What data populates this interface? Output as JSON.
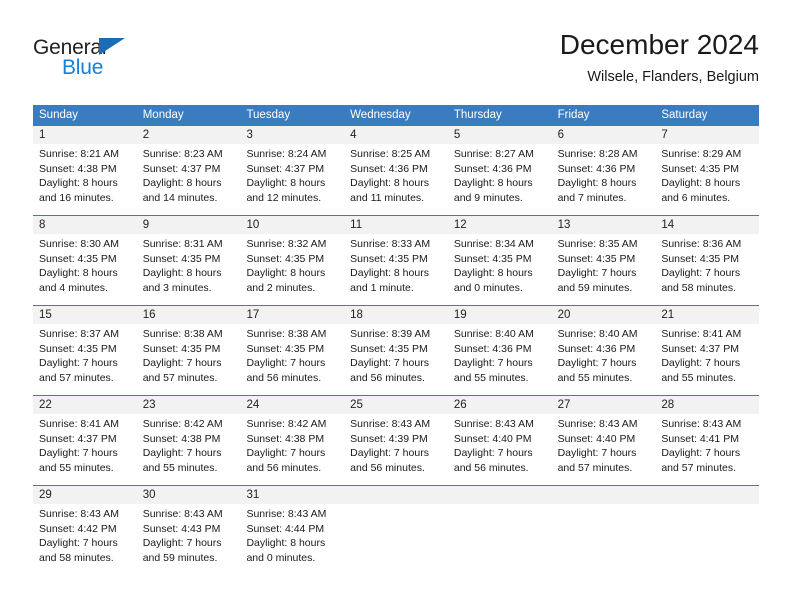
{
  "brand": {
    "name_part1": "General",
    "name_part2": "Blue",
    "triangle_color": "#1b6cb5",
    "blue_color": "#1b7fd4"
  },
  "header": {
    "title": "December 2024",
    "subtitle": "Wilsele, Flanders, Belgium"
  },
  "theme": {
    "header_bg": "#3a7cbf",
    "header_text": "#ffffff",
    "daynum_bg": "#f2f2f2",
    "cell_bg": "#ffffff",
    "border": "#3a7cbf"
  },
  "weekdays": [
    "Sunday",
    "Monday",
    "Tuesday",
    "Wednesday",
    "Thursday",
    "Friday",
    "Saturday"
  ],
  "weeks": [
    [
      {
        "day": "1",
        "sunrise": "Sunrise: 8:21 AM",
        "sunset": "Sunset: 4:38 PM",
        "daylight1": "Daylight: 8 hours",
        "daylight2": "and 16 minutes."
      },
      {
        "day": "2",
        "sunrise": "Sunrise: 8:23 AM",
        "sunset": "Sunset: 4:37 PM",
        "daylight1": "Daylight: 8 hours",
        "daylight2": "and 14 minutes."
      },
      {
        "day": "3",
        "sunrise": "Sunrise: 8:24 AM",
        "sunset": "Sunset: 4:37 PM",
        "daylight1": "Daylight: 8 hours",
        "daylight2": "and 12 minutes."
      },
      {
        "day": "4",
        "sunrise": "Sunrise: 8:25 AM",
        "sunset": "Sunset: 4:36 PM",
        "daylight1": "Daylight: 8 hours",
        "daylight2": "and 11 minutes."
      },
      {
        "day": "5",
        "sunrise": "Sunrise: 8:27 AM",
        "sunset": "Sunset: 4:36 PM",
        "daylight1": "Daylight: 8 hours",
        "daylight2": "and 9 minutes."
      },
      {
        "day": "6",
        "sunrise": "Sunrise: 8:28 AM",
        "sunset": "Sunset: 4:36 PM",
        "daylight1": "Daylight: 8 hours",
        "daylight2": "and 7 minutes."
      },
      {
        "day": "7",
        "sunrise": "Sunrise: 8:29 AM",
        "sunset": "Sunset: 4:35 PM",
        "daylight1": "Daylight: 8 hours",
        "daylight2": "and 6 minutes."
      }
    ],
    [
      {
        "day": "8",
        "sunrise": "Sunrise: 8:30 AM",
        "sunset": "Sunset: 4:35 PM",
        "daylight1": "Daylight: 8 hours",
        "daylight2": "and 4 minutes."
      },
      {
        "day": "9",
        "sunrise": "Sunrise: 8:31 AM",
        "sunset": "Sunset: 4:35 PM",
        "daylight1": "Daylight: 8 hours",
        "daylight2": "and 3 minutes."
      },
      {
        "day": "10",
        "sunrise": "Sunrise: 8:32 AM",
        "sunset": "Sunset: 4:35 PM",
        "daylight1": "Daylight: 8 hours",
        "daylight2": "and 2 minutes."
      },
      {
        "day": "11",
        "sunrise": "Sunrise: 8:33 AM",
        "sunset": "Sunset: 4:35 PM",
        "daylight1": "Daylight: 8 hours",
        "daylight2": "and 1 minute."
      },
      {
        "day": "12",
        "sunrise": "Sunrise: 8:34 AM",
        "sunset": "Sunset: 4:35 PM",
        "daylight1": "Daylight: 8 hours",
        "daylight2": "and 0 minutes."
      },
      {
        "day": "13",
        "sunrise": "Sunrise: 8:35 AM",
        "sunset": "Sunset: 4:35 PM",
        "daylight1": "Daylight: 7 hours",
        "daylight2": "and 59 minutes."
      },
      {
        "day": "14",
        "sunrise": "Sunrise: 8:36 AM",
        "sunset": "Sunset: 4:35 PM",
        "daylight1": "Daylight: 7 hours",
        "daylight2": "and 58 minutes."
      }
    ],
    [
      {
        "day": "15",
        "sunrise": "Sunrise: 8:37 AM",
        "sunset": "Sunset: 4:35 PM",
        "daylight1": "Daylight: 7 hours",
        "daylight2": "and 57 minutes."
      },
      {
        "day": "16",
        "sunrise": "Sunrise: 8:38 AM",
        "sunset": "Sunset: 4:35 PM",
        "daylight1": "Daylight: 7 hours",
        "daylight2": "and 57 minutes."
      },
      {
        "day": "17",
        "sunrise": "Sunrise: 8:38 AM",
        "sunset": "Sunset: 4:35 PM",
        "daylight1": "Daylight: 7 hours",
        "daylight2": "and 56 minutes."
      },
      {
        "day": "18",
        "sunrise": "Sunrise: 8:39 AM",
        "sunset": "Sunset: 4:35 PM",
        "daylight1": "Daylight: 7 hours",
        "daylight2": "and 56 minutes."
      },
      {
        "day": "19",
        "sunrise": "Sunrise: 8:40 AM",
        "sunset": "Sunset: 4:36 PM",
        "daylight1": "Daylight: 7 hours",
        "daylight2": "and 55 minutes."
      },
      {
        "day": "20",
        "sunrise": "Sunrise: 8:40 AM",
        "sunset": "Sunset: 4:36 PM",
        "daylight1": "Daylight: 7 hours",
        "daylight2": "and 55 minutes."
      },
      {
        "day": "21",
        "sunrise": "Sunrise: 8:41 AM",
        "sunset": "Sunset: 4:37 PM",
        "daylight1": "Daylight: 7 hours",
        "daylight2": "and 55 minutes."
      }
    ],
    [
      {
        "day": "22",
        "sunrise": "Sunrise: 8:41 AM",
        "sunset": "Sunset: 4:37 PM",
        "daylight1": "Daylight: 7 hours",
        "daylight2": "and 55 minutes."
      },
      {
        "day": "23",
        "sunrise": "Sunrise: 8:42 AM",
        "sunset": "Sunset: 4:38 PM",
        "daylight1": "Daylight: 7 hours",
        "daylight2": "and 55 minutes."
      },
      {
        "day": "24",
        "sunrise": "Sunrise: 8:42 AM",
        "sunset": "Sunset: 4:38 PM",
        "daylight1": "Daylight: 7 hours",
        "daylight2": "and 56 minutes."
      },
      {
        "day": "25",
        "sunrise": "Sunrise: 8:43 AM",
        "sunset": "Sunset: 4:39 PM",
        "daylight1": "Daylight: 7 hours",
        "daylight2": "and 56 minutes."
      },
      {
        "day": "26",
        "sunrise": "Sunrise: 8:43 AM",
        "sunset": "Sunset: 4:40 PM",
        "daylight1": "Daylight: 7 hours",
        "daylight2": "and 56 minutes."
      },
      {
        "day": "27",
        "sunrise": "Sunrise: 8:43 AM",
        "sunset": "Sunset: 4:40 PM",
        "daylight1": "Daylight: 7 hours",
        "daylight2": "and 57 minutes."
      },
      {
        "day": "28",
        "sunrise": "Sunrise: 8:43 AM",
        "sunset": "Sunset: 4:41 PM",
        "daylight1": "Daylight: 7 hours",
        "daylight2": "and 57 minutes."
      }
    ],
    [
      {
        "day": "29",
        "sunrise": "Sunrise: 8:43 AM",
        "sunset": "Sunset: 4:42 PM",
        "daylight1": "Daylight: 7 hours",
        "daylight2": "and 58 minutes."
      },
      {
        "day": "30",
        "sunrise": "Sunrise: 8:43 AM",
        "sunset": "Sunset: 4:43 PM",
        "daylight1": "Daylight: 7 hours",
        "daylight2": "and 59 minutes."
      },
      {
        "day": "31",
        "sunrise": "Sunrise: 8:43 AM",
        "sunset": "Sunset: 4:44 PM",
        "daylight1": "Daylight: 8 hours",
        "daylight2": "and 0 minutes."
      },
      {
        "day": "",
        "sunrise": "",
        "sunset": "",
        "daylight1": "",
        "daylight2": ""
      },
      {
        "day": "",
        "sunrise": "",
        "sunset": "",
        "daylight1": "",
        "daylight2": ""
      },
      {
        "day": "",
        "sunrise": "",
        "sunset": "",
        "daylight1": "",
        "daylight2": ""
      },
      {
        "day": "",
        "sunrise": "",
        "sunset": "",
        "daylight1": "",
        "daylight2": ""
      }
    ]
  ]
}
